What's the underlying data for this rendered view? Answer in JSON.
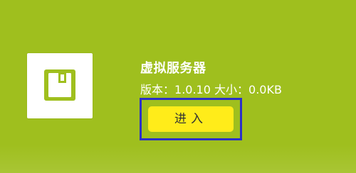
{
  "app": {
    "name": "虚拟服务器",
    "version_label": "版本：",
    "version": "1.0.10",
    "size_label": "大小：",
    "size": "0.0KB",
    "icon": "save-disk-icon",
    "enter_label": "进入"
  },
  "colors": {
    "background": "#9fbf1e",
    "tile": "#ffffff",
    "button": "#ffec1a",
    "focus_border": "#2c30c8",
    "text": "#ffffff"
  }
}
